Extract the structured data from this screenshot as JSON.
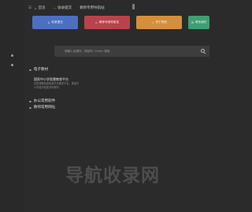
{
  "colors": {
    "background": "#2b2b2c",
    "btn_blue": "#4c6fc0",
    "btn_red": "#b8434b",
    "btn_orange": "#d48f3d",
    "btn_green": "#3f9f72"
  },
  "nav": {
    "items": [
      {
        "icon": "home-icon",
        "label": "首页"
      },
      {
        "icon": "star-icon",
        "label": "收录提交"
      },
      {
        "icon": "",
        "label": "教师专用导航站"
      }
    ]
  },
  "quick_buttons": [
    {
      "icon": "user-icon",
      "label": "收录提交"
    },
    {
      "icon": "link-icon",
      "label": "教师专用导航站"
    },
    {
      "icon": "star-icon",
      "label": "关于导航"
    },
    {
      "icon": "mail-icon",
      "label": "联系我们"
    }
  ],
  "search": {
    "placeholder": "请输入关键字，按回车 / Enter 搜索"
  },
  "sections": [
    {
      "icon": "book-icon",
      "title": "电子教材"
    },
    {
      "icon": "folder-icon",
      "title": "办公常用软件"
    },
    {
      "icon": "globe-icon",
      "title": "教师常用网址"
    }
  ],
  "card": {
    "title": "国家中小学智慧教育平台",
    "description": "优质课程资源免费共享服务平台，覆盖中小学各学段各学科教材"
  },
  "watermark": "导航收录网"
}
